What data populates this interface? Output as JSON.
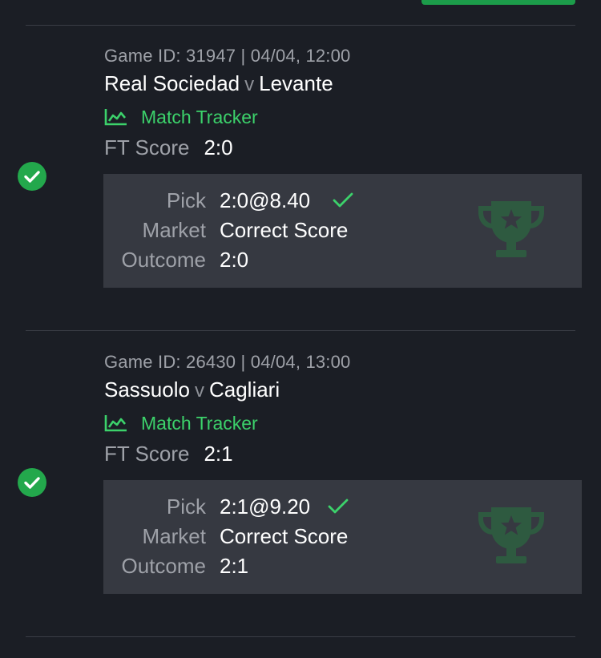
{
  "bets": [
    {
      "meta": "Game ID: 31947 | 04/04, 12:00",
      "home": "Real Sociedad",
      "vs": "v",
      "away": "Levante",
      "tracker_label": "Match Tracker",
      "ft_label": "FT Score",
      "ft_value": "2:0",
      "pick_label": "Pick",
      "pick_value": "2:0@8.40",
      "market_label": "Market",
      "market_value": "Correct Score",
      "outcome_label": "Outcome",
      "outcome_value": "2:0",
      "status": "won"
    },
    {
      "meta": "Game ID: 26430 | 04/04, 13:00",
      "home": "Sassuolo",
      "vs": "v",
      "away": "Cagliari",
      "tracker_label": "Match Tracker",
      "ft_label": "FT Score",
      "ft_value": "2:1",
      "pick_label": "Pick",
      "pick_value": "2:1@9.20",
      "market_label": "Market",
      "market_value": "Correct Score",
      "outcome_label": "Outcome",
      "outcome_value": "2:1",
      "status": "won"
    }
  ],
  "colors": {
    "background": "#1b1e25",
    "accent_green": "#3cd26b",
    "status_green": "#23a84c",
    "pick_box": "#363941"
  },
  "icons": {
    "status": "check-circle-icon",
    "tracker": "line-chart-icon",
    "pick_result": "checkmark-icon",
    "watermark": "trophy-icon"
  }
}
